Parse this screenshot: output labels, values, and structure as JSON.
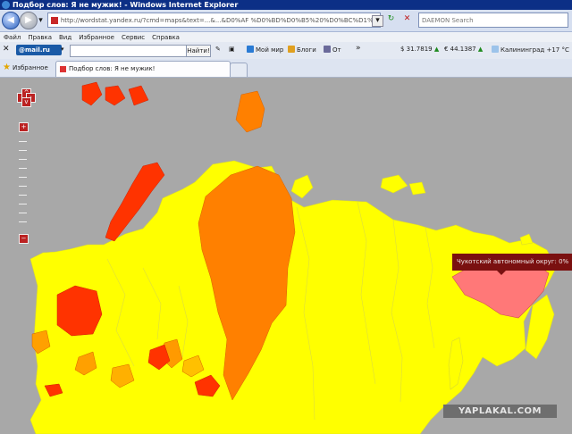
{
  "window": {
    "title": "Подбор слов: Я не мужик! - Windows Internet Explorer"
  },
  "address_bar": {
    "url": "http://wordstat.yandex.ru/?cmd=maps&text=...&...&D0%AF %D0%BD%D0%B5%20%D0%BC%D1%83...",
    "search_placeholder": "DAEMON Search"
  },
  "menu": {
    "items": [
      "Файл",
      "Правка",
      "Вид",
      "Избранное",
      "Сервис",
      "Справка"
    ]
  },
  "toolbar": {
    "brand": "@mail.ru",
    "find_label": "Найти!",
    "items": [
      "Мой мир",
      "Блоги",
      "От"
    ],
    "currency_usd": "$ 31.7819",
    "currency_eur": "€ 44.1387",
    "weather": "Калининград +17 °C"
  },
  "favorites_bar": {
    "label": "Избранное",
    "tab_title": "Подбор слов: Я не мужик!"
  },
  "map": {
    "tooltip": "Чукотский автономный округ: 0%",
    "legend_colors": {
      "background": "#a8a8a8",
      "high": "#ff3300",
      "mid": "#ff8000",
      "low": "#ffff00",
      "selected": "#ff7878"
    }
  },
  "watermark": "YAPLAKAL.COM"
}
